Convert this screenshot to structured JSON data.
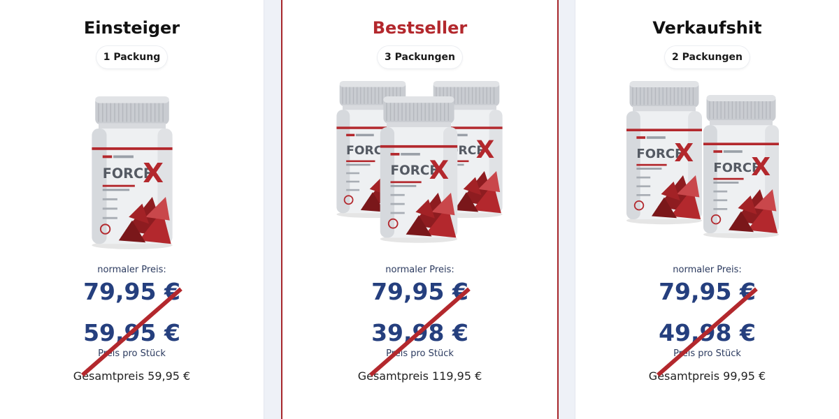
{
  "offers": [
    {
      "title": "Einsteiger",
      "package": "1 Packung",
      "bottle_count": 1,
      "brand_text": "FORCE",
      "brand_x": "X",
      "normal_label": "normaler Preis:",
      "old_price": "79,95 €",
      "price": "59,95 €",
      "unit_label": "Preis pro Stück",
      "total": "Gesamtpreis 59,95 €"
    },
    {
      "title": "Bestseller",
      "package": "3 Packungen",
      "bottle_count": 3,
      "highlight": true,
      "brand_text": "FORCE",
      "brand_x": "X",
      "normal_label": "normaler Preis:",
      "old_price": "79,95 €",
      "price": "39,98 €",
      "unit_label": "Preis pro Stück",
      "total": "Gesamtpreis 119,95 €"
    },
    {
      "title": "Verkaufshit",
      "package": "2 Packungen",
      "bottle_count": 2,
      "brand_text": "FORCE",
      "brand_x": "X",
      "normal_label": "normaler Preis:",
      "old_price": "79,95 €",
      "price": "49,98 €",
      "unit_label": "Preis pro Stück",
      "total": "Gesamtpreis 99,95 €"
    }
  ],
  "colors": {
    "accent": "#b3282d",
    "price_blue": "#253f7e",
    "background": "#eef1f7"
  }
}
